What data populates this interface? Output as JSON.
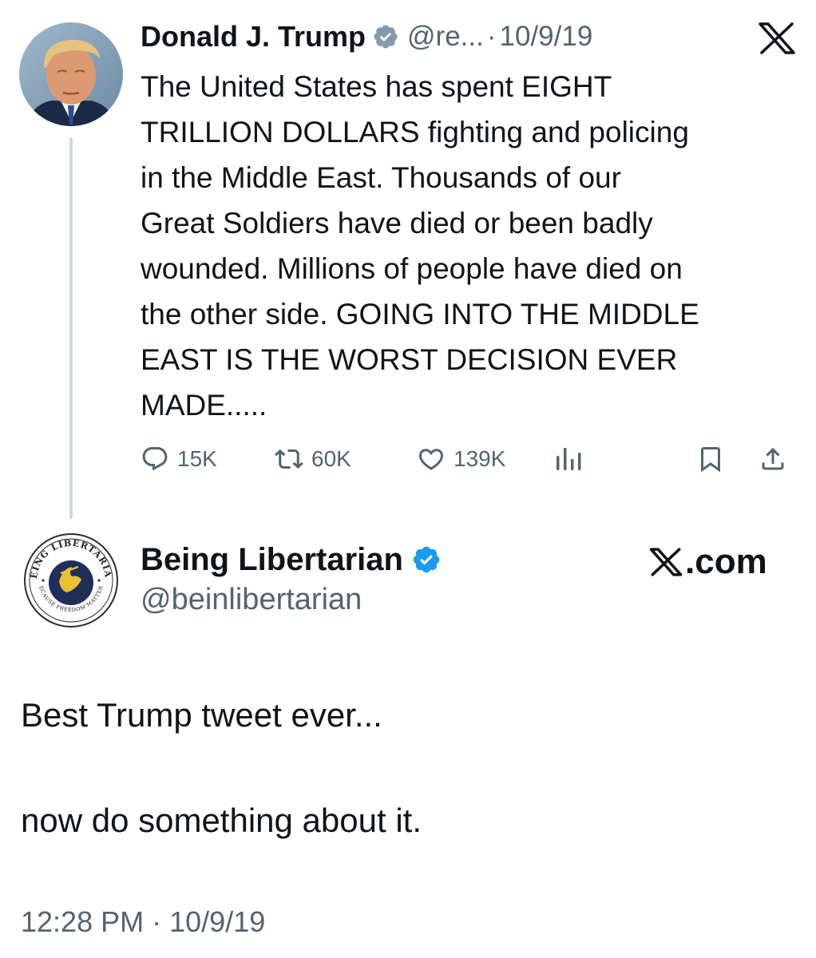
{
  "quoted_tweet": {
    "author": {
      "name": "Donald J. Trump",
      "handle": "@re...",
      "verified_badge_color": "#829aab"
    },
    "separator": "·",
    "date": "10/9/19",
    "platform_icon": "x-logo-icon",
    "text_lines": [
      "The United States has spent EIGHT",
      "TRILLION DOLLARS fighting and policing",
      "in the Middle East. Thousands of our",
      "Great Soldiers have died or been badly",
      "wounded. Millions of people have died on",
      "the other side. GOING INTO THE MIDDLE",
      "EAST IS THE WORST DECISION EVER",
      "MADE....."
    ],
    "stats": {
      "replies": "15K",
      "reposts": "60K",
      "likes": "139K"
    }
  },
  "author_card": {
    "name": "Being Libertarian",
    "handle": "@beinlibertarian",
    "verified_badge_color": "#1d9bf0",
    "avatar_text_top": "BEING LIBERTARIAN",
    "avatar_text_bottom": "BECAUSE FREEDOM MATTERS",
    "site": ".com"
  },
  "post": {
    "line1": "Best Trump tweet ever...",
    "line2": "now do something about it."
  },
  "timestamp": {
    "time": "12:28 PM",
    "separator": "·",
    "date": "10/9/19"
  },
  "colors": {
    "text": "#0f1419",
    "secondary": "#536471",
    "thread_line": "#cfd9de",
    "verified_blue": "#1d9bf0",
    "verified_gray": "#829aab"
  }
}
